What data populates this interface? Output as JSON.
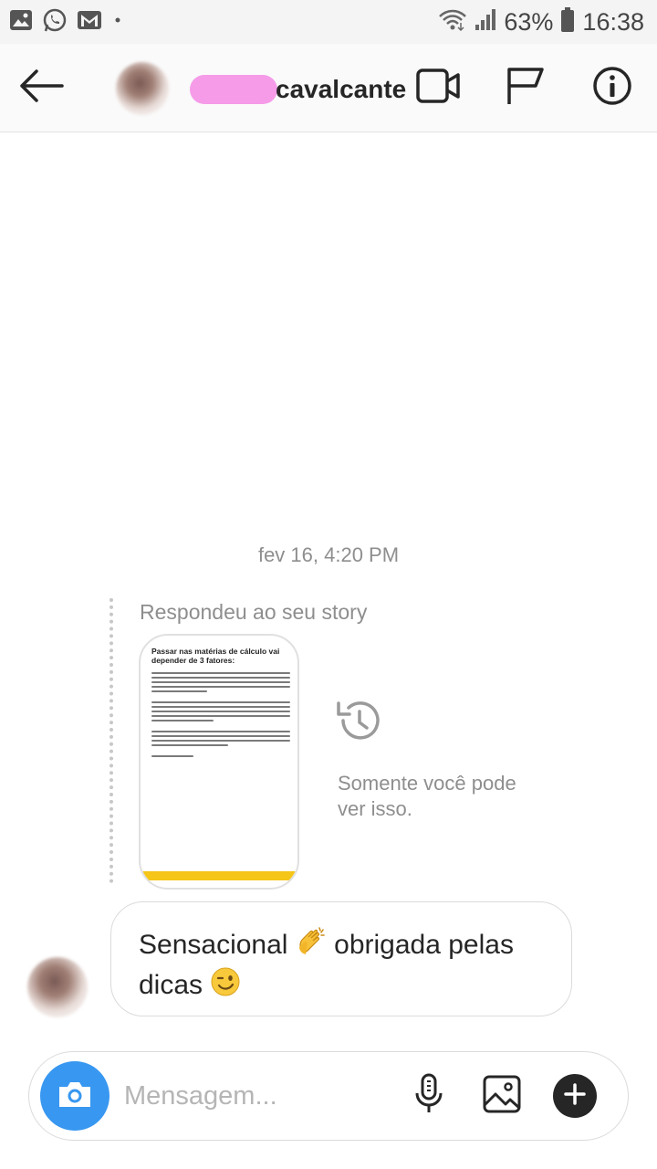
{
  "status_bar": {
    "battery": "63%",
    "time": "16:38",
    "left_icons": [
      "gallery-icon",
      "whatsapp-icon",
      "gmail-icon",
      "dot-icon"
    ],
    "right_icons": [
      "wifi-icon",
      "cellular-signal-icon",
      "battery-icon"
    ]
  },
  "header": {
    "username_visible": "cavalcante",
    "icons": [
      "back-arrow-icon",
      "video-call-icon",
      "flag-icon",
      "info-icon"
    ]
  },
  "conversation": {
    "timestamp": "fev 16, 4:20 PM",
    "story_reply": {
      "caption": "Respondeu ao seu story",
      "preview_title": "Passar nas matérias de cálculo vai depender de 3 fatores:",
      "private_note": "Somente você pode ver isso."
    },
    "message": {
      "text_part1": "Sensacional",
      "text_part2": "obrigada pelas dicas",
      "emojis": [
        "clapping-hands-emoji",
        "winking-face-emoji"
      ]
    }
  },
  "composer": {
    "placeholder": "Mensagem...",
    "icons": [
      "camera-icon",
      "microphone-icon",
      "gallery-icon",
      "plus-icon"
    ]
  },
  "colors": {
    "accent_blue": "#3897f0",
    "text_primary": "#262626",
    "text_secondary": "#8e8e8e",
    "redaction_pink": "#f59be8",
    "story_footer_yellow": "#f5c518"
  }
}
